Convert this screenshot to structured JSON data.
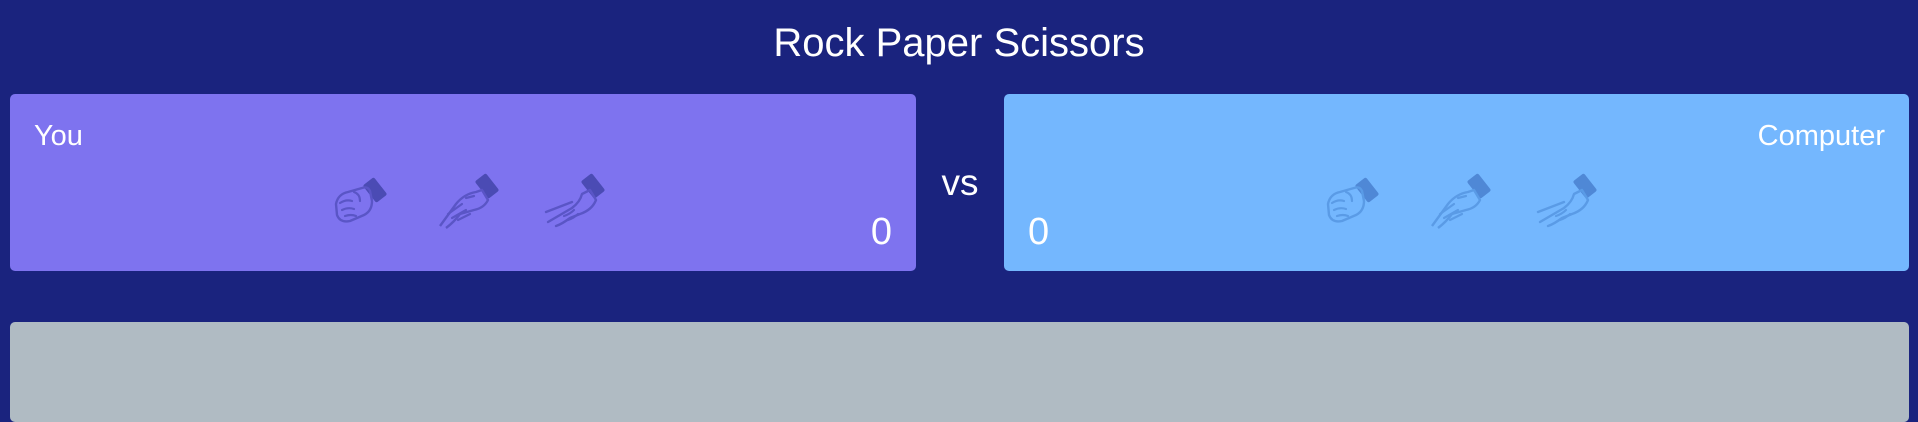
{
  "header": {
    "title": "Rock Paper Scissors"
  },
  "player": {
    "label": "You",
    "score": "0",
    "choices": [
      "rock-hand-icon",
      "paper-hand-icon",
      "scissors-hand-icon"
    ]
  },
  "computer": {
    "label": "Computer",
    "score": "0",
    "choices": [
      "rock-hand-icon",
      "paper-hand-icon",
      "scissors-hand-icon"
    ]
  },
  "versus": {
    "label": "vs"
  },
  "colors": {
    "background": "#1a237e",
    "player_panel": "#7e73ef",
    "computer_panel": "#74b7fe",
    "result_panel": "#b0bbc3"
  }
}
